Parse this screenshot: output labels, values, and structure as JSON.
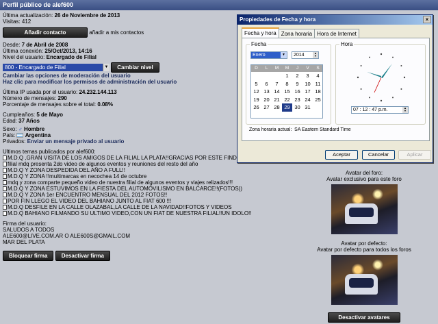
{
  "window": {
    "title": "Perfil público de alef600"
  },
  "profile": {
    "last_update_label": "Última actualización:",
    "last_update": "26 de Noviembre de 2013",
    "visits_label": "Visitas:",
    "visits": "412",
    "add_contact_button": "Añadir contacto",
    "add_contact_hint": "añadir a mis contactos",
    "since_label": "Desde:",
    "since": "7 de Abril de 2008",
    "last_login_label": "Última conexión:",
    "last_login": "25/Oct/2013, 14:16",
    "level_label": "Nivel del usuario:",
    "level": "Encargado de Filial",
    "level_select": "800 - Encargado de Filial",
    "change_level_button": "Cambiar nivel",
    "mod_options": "Cambiar las opciones de moderación del usuario",
    "admin_perms": "Haz clic para modificar los permisos de administración del usuario",
    "last_ip_label": "Última IP usada por el usuario:",
    "last_ip": "24.232.144.113",
    "messages_label": "Número de mensajes:",
    "messages": "290",
    "percent_label": "Porcentaje de mensajes sobre el total:",
    "percent": "0.08%",
    "birthday_label": "Cumpleaños:",
    "birthday": "5 de Mayo",
    "age_label": "Edad:",
    "age": "37 Años",
    "sex_label": "Sexo:",
    "sex": "Hombre",
    "country_label": "País:",
    "country": "Argentina",
    "private_label": "Privados:",
    "private_link": "Enviar un mensaje privado al usuario",
    "topics_title": "Ultimos temas publicados por alef600:",
    "topics": [
      "M.D.Q ,GRAN VISITA DE LOS AMIGOS DE LA FILIAL LA PLATA!!GRACIAS POR ESTE FINDE INCREIBLE!!",
      "filial mdq presenta 2do video de algunos eventos y reuniones del resto del año",
      "M.D.Q Y ZONA DESPEDIDA DEL AÑO A FULL!!",
      "M.D.Q Y ZONA !!multimarcas en necochea 14 de octubre",
      "mdq y zona comparte pequeño video de nuestra filial de algunos eventos y viajes relizados!!!",
      "M.D.Q Y ZONA ESTUVIMOS EN LA FIESTA DEL AUTOMOVILISMO EN BALCARCE!!(FOTOS))",
      "M.D.Q Y ZONA 1er ENCUENTRO MENSUAL DEL 2012 FOTOS!!",
      "POR FIN LLEGO EL VIDEO DEL BAHIANO JUNTO AL FIAT 600 !!!",
      "M.D.Q DESFILE EN LA CALLE OLAZABAL,LA CALLE DE LA NAVIDAD!!FOTOS Y VIDEOS",
      "M.D.Q BAHIANO FILMANDO SU ULTIMO VIDEO,CON UN FIAT DE NUESTRA FILIAL!!UN IDOLO!!"
    ],
    "signature_title": "Firma del usuario:",
    "signature_lines": [
      "SALUDOS A TODOS",
      "ALE600@LIVE.COM.AR O ALE600S@GMAIL.COM",
      "MAR DEL PLATA"
    ],
    "block_signature_button": "Bloquear firma",
    "disable_signature_button": "Desactivar firma"
  },
  "avatars": {
    "forum_title": "Avatar del foro:",
    "forum_desc": "Avatar exclusivo para este foro",
    "default_title": "Avatar por defecto:",
    "default_desc": "Avatar por defecto para todos los foros",
    "disable_button": "Desactivar avatares"
  },
  "dialog": {
    "title": "Propiedades de Fecha y hora",
    "close": "×",
    "tabs": [
      "Fecha y hora",
      "Zona horaria",
      "Hora de Internet"
    ],
    "date_group": "Fecha",
    "time_group": "Hora",
    "month": "Enero",
    "year": "2014",
    "weekdays": [
      "D",
      "L",
      "M",
      "M",
      "J",
      "V",
      "S"
    ],
    "days": [
      "",
      "",
      "",
      "1",
      "2",
      "3",
      "4",
      "5",
      "6",
      "7",
      "8",
      "9",
      "10",
      "11",
      "12",
      "13",
      "14",
      "15",
      "16",
      "17",
      "18",
      "19",
      "20",
      "21",
      "22",
      "23",
      "24",
      "25",
      "26",
      "27",
      "28",
      "29",
      "30",
      "31",
      "",
      ""
    ],
    "selected_day": "29",
    "time": "07 : 12 : 47 p.m.",
    "timezone_label": "Zona horaria actual:",
    "timezone": "SA Eastern Standard Time",
    "ok_button": "Aceptar",
    "cancel_button": "Cancelar",
    "apply_button": "Aplicar"
  },
  "colors": {
    "accent": "#0a246a",
    "page_bg": "#c6c9d1",
    "select_bg": "#2a4aa8"
  },
  "icons": {
    "sex": "male-icon",
    "country": "argentina-flag-icon",
    "topic": "document-icon",
    "close": "close-icon"
  }
}
